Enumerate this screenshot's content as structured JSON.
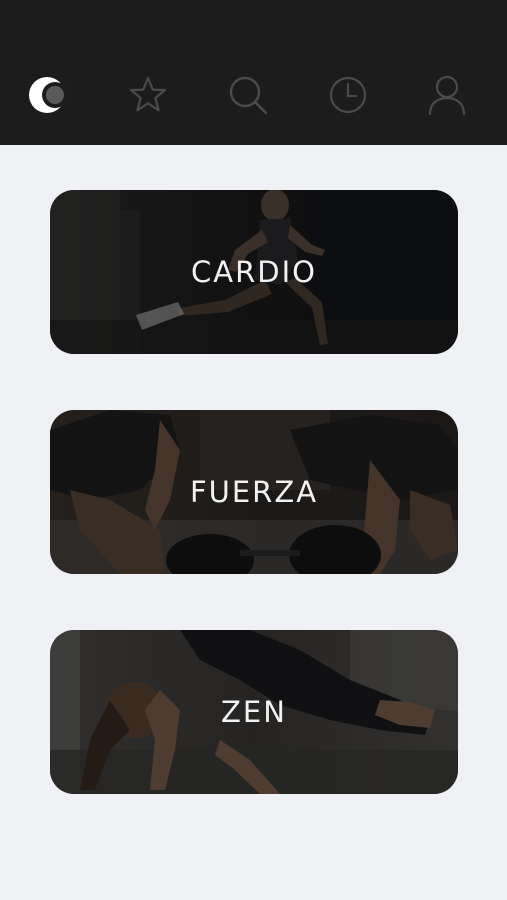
{
  "nav": {
    "items": [
      {
        "name": "home",
        "icon": "moon-logo-icon",
        "active": true
      },
      {
        "name": "favorites",
        "icon": "star-icon",
        "active": false
      },
      {
        "name": "search",
        "icon": "search-icon",
        "active": false
      },
      {
        "name": "history",
        "icon": "clock-icon",
        "active": false
      },
      {
        "name": "profile",
        "icon": "user-icon",
        "active": false
      }
    ],
    "icon_color": "#4a4a4a",
    "active_color": "#ffffff",
    "background": "#1c1c1c"
  },
  "categories": [
    {
      "label": "CARDIO"
    },
    {
      "label": "FUERZA"
    },
    {
      "label": "ZEN"
    }
  ],
  "colors": {
    "page_background": "#eff1f5",
    "card_label": "#f2f2f2"
  }
}
